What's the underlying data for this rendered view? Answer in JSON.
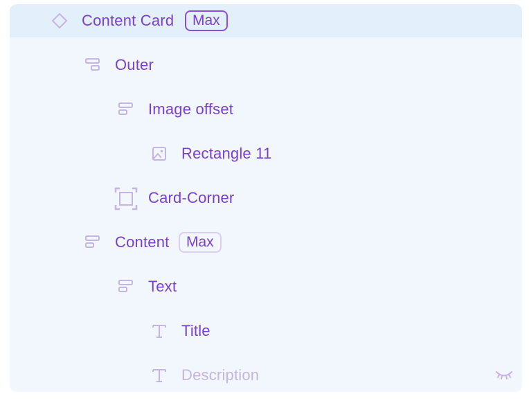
{
  "layers": [
    {
      "label": "Content Card",
      "icon": "component-diamond-icon",
      "badge": "Max",
      "selected": true
    },
    {
      "label": "Outer",
      "icon": "stack-layout-icon"
    },
    {
      "label": "Image offset",
      "icon": "stack-layout-icon"
    },
    {
      "label": "Rectangle 11",
      "icon": "image-icon"
    },
    {
      "label": "Card-Corner",
      "icon": "frame-corners-icon"
    },
    {
      "label": "Content",
      "icon": "stack-layout-icon",
      "badge": "Max"
    },
    {
      "label": "Text",
      "icon": "stack-layout-icon"
    },
    {
      "label": "Title",
      "icon": "text-icon"
    },
    {
      "label": "Description",
      "icon": "text-icon",
      "hidden": true
    }
  ],
  "colors": {
    "accent": "#7b3fd0",
    "muted": "#c6b4e4",
    "panel_bg": "#f1f7fd",
    "selected_bg": "#e3f0fc"
  }
}
